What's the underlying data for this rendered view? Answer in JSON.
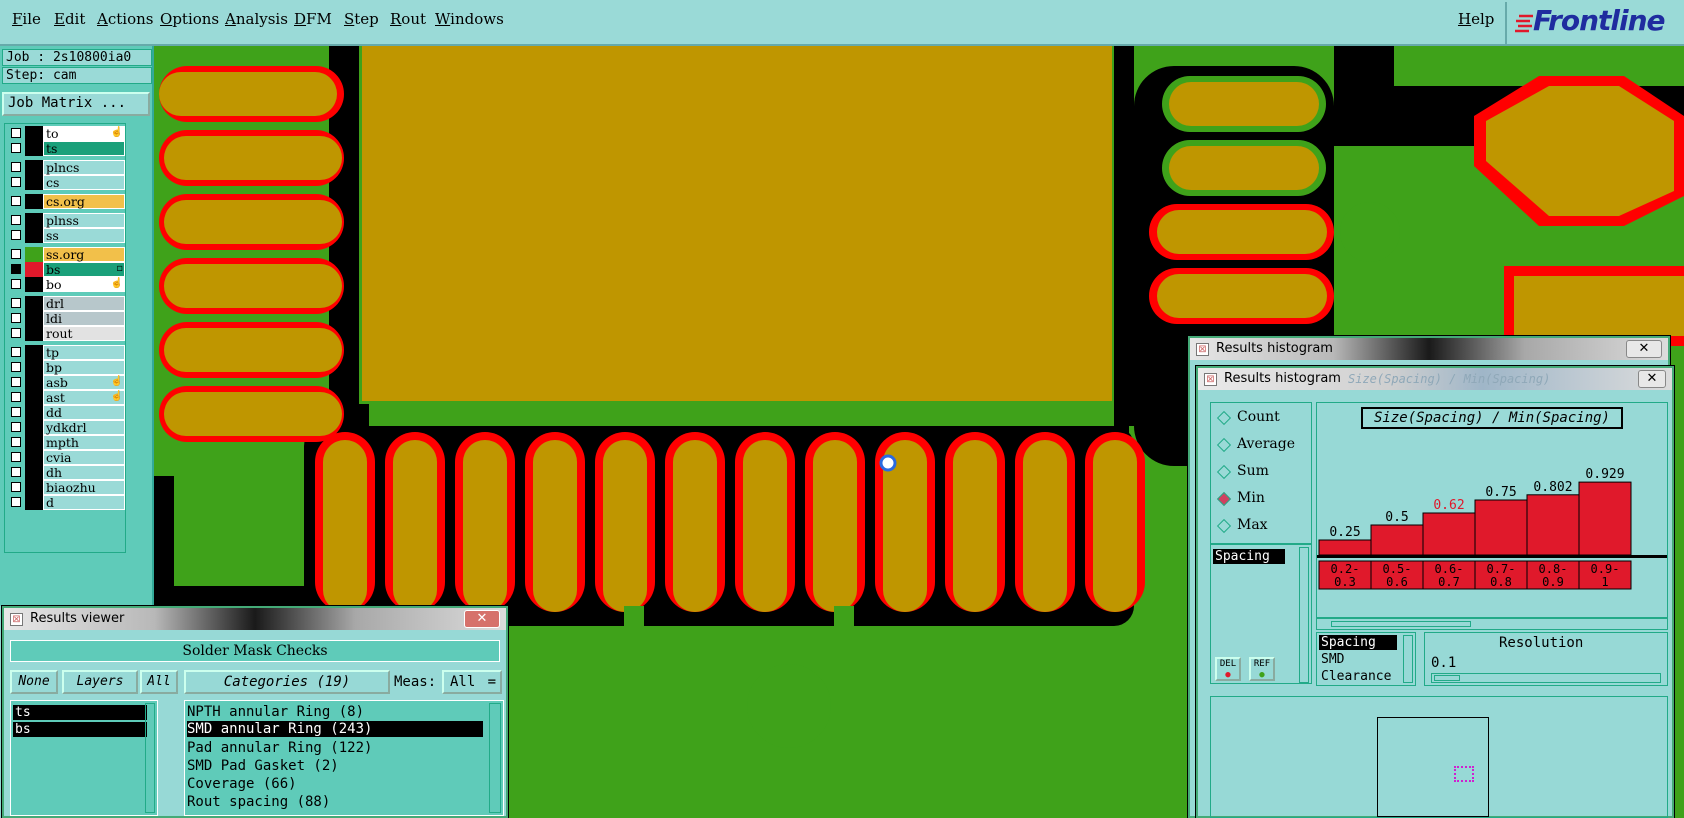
{
  "menu": {
    "items": [
      "File",
      "Edit",
      "Actions",
      "Options",
      "Analysis",
      "DFM",
      "Step",
      "Rout",
      "Windows"
    ],
    "help": "Help",
    "logo": "Frontline"
  },
  "job": {
    "job_label": "Job : 2s10800ia0",
    "step_label": "Step: cam",
    "matrix_button": "Job Matrix ..."
  },
  "layers": [
    {
      "name": "to",
      "color": "#ffffff",
      "mark": "☝"
    },
    {
      "name": "ts",
      "color": "#1aa07a",
      "mark": ""
    },
    {
      "name": "plncs",
      "color": "#9adad7",
      "mark": ""
    },
    {
      "name": "cs",
      "color": "#9adad7",
      "mark": ""
    },
    {
      "name": "cs.org",
      "color": "#f2c04a",
      "mark": ""
    },
    {
      "name": "plnss",
      "color": "#9adad7",
      "mark": ""
    },
    {
      "name": "ss",
      "color": "#9adad7",
      "mark": ""
    },
    {
      "name": "ss.org",
      "color": "#f2c04a",
      "mark": ""
    },
    {
      "name": "bs",
      "color": "#1aa07a",
      "mark": "▫"
    },
    {
      "name": "bo",
      "color": "#ffffff",
      "mark": "☝"
    },
    {
      "name": "drl",
      "color": "#b7c7cb",
      "mark": ""
    },
    {
      "name": "ldi",
      "color": "#b7c7cb",
      "mark": ""
    },
    {
      "name": "rout",
      "color": "#e2e2e2",
      "mark": ""
    },
    {
      "name": "tp",
      "color": "#9adad7",
      "mark": ""
    },
    {
      "name": "bp",
      "color": "#9adad7",
      "mark": ""
    },
    {
      "name": "asb",
      "color": "#9adad7",
      "mark": "☝"
    },
    {
      "name": "ast",
      "color": "#9adad7",
      "mark": "☝"
    },
    {
      "name": "dd",
      "color": "#9adad7",
      "mark": ""
    },
    {
      "name": "ydkdrl",
      "color": "#9adad7",
      "mark": ""
    },
    {
      "name": "mpth",
      "color": "#9adad7",
      "mark": ""
    },
    {
      "name": "cvia",
      "color": "#9adad7",
      "mark": ""
    },
    {
      "name": "dh",
      "color": "#9adad7",
      "mark": ""
    },
    {
      "name": "biaozhu",
      "color": "#9adad7",
      "mark": ""
    },
    {
      "name": "d",
      "color": "#9adad7",
      "mark": ""
    }
  ],
  "results_viewer": {
    "title": "Results viewer",
    "close": "✕",
    "header": "Solder Mask Checks",
    "btn_none": "None",
    "btn_layers": "Layers",
    "btn_all": "All",
    "categories_label": "Categories (19)",
    "meas_label": "Meas:",
    "meas_value": "All",
    "layer_items": [
      "ts",
      "bs"
    ],
    "categories": [
      "NPTH annular Ring (8)",
      "SMD annular Ring (243)",
      "Pad annular Ring (122)",
      "SMD Pad Gasket (2)",
      "Coverage (66)",
      "Rout spacing (88)"
    ]
  },
  "histogram_back": {
    "title": "Results histogram",
    "close": "✕"
  },
  "histogram": {
    "title": "Results histogram",
    "faded_title": "Size(Spacing) / Min(Spacing)",
    "close": "✕",
    "heading": "Size(Spacing) / Min(Spacing)",
    "modes": [
      {
        "label": "Count",
        "selected": false
      },
      {
        "label": "Average",
        "selected": false
      },
      {
        "label": "Sum",
        "selected": false
      },
      {
        "label": "Min",
        "selected": true
      },
      {
        "label": "Max",
        "selected": false
      }
    ],
    "measure_list": [
      "Spacing"
    ],
    "del_label": "DEL",
    "ref_label": "REF",
    "attr_list": [
      "Spacing",
      "SMD",
      "Clearance"
    ],
    "resolution_label": "Resolution",
    "resolution_value": "0.1"
  },
  "chart_data": {
    "type": "bar",
    "title": "Size(Spacing) / Min(Spacing)",
    "categories": [
      "0.2-0.3",
      "0.5-0.6",
      "0.6-0.7",
      "0.7-0.8",
      "0.8-0.9",
      "0.9-1"
    ],
    "bin_lines": [
      [
        "0.2-",
        "0.3"
      ],
      [
        "0.5-",
        "0.6"
      ],
      [
        "0.6-",
        "0.7"
      ],
      [
        "0.7-",
        "0.8"
      ],
      [
        "0.8-",
        "0.9"
      ],
      [
        "0.9-",
        "1"
      ]
    ],
    "values": [
      0.25,
      0.5,
      0.62,
      0.75,
      0.802,
      0.929
    ],
    "value_labels": [
      "0.25",
      "0.5",
      "0.62",
      "0.75",
      "0.802",
      "0.929"
    ],
    "highlight_index": 2,
    "highlight_color": "#e0192b",
    "bar_color": "#e0192b",
    "ylim": [
      0,
      1
    ]
  }
}
